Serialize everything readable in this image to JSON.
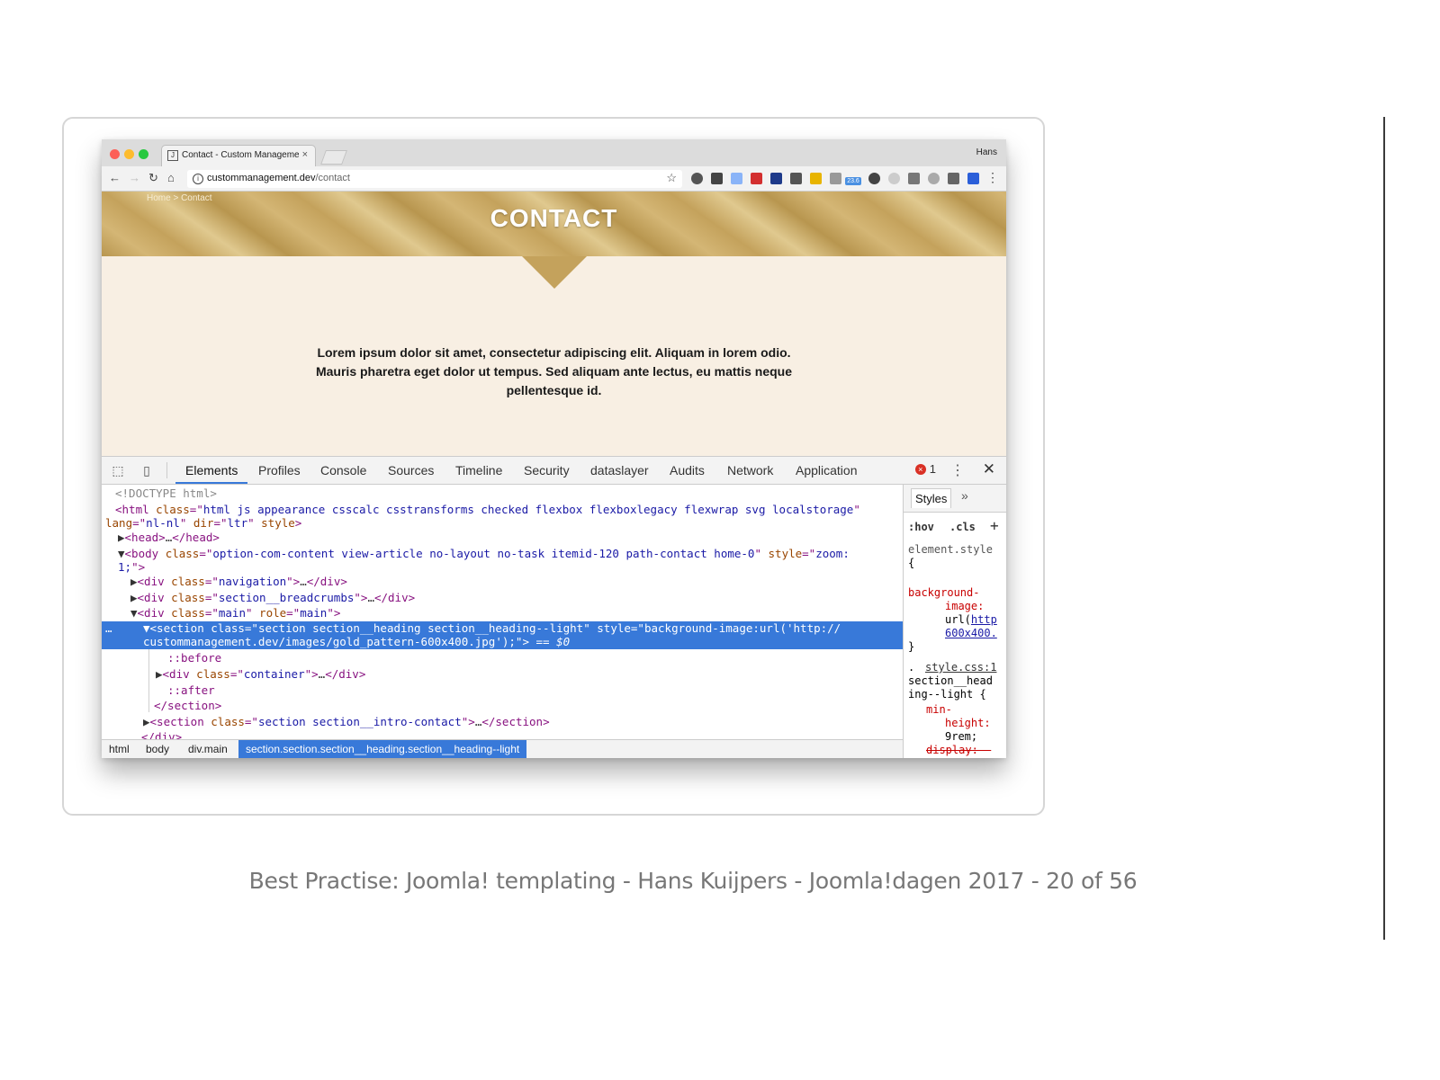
{
  "browser": {
    "tab_title": "Contact - Custom Managemen",
    "tab_favicon": "J",
    "tab_close": "×",
    "profile_name": "Hans",
    "url_host": "custommanagement.dev",
    "url_path": "/contact"
  },
  "icons": {
    "back": "←",
    "forward": "→",
    "reload": "↻",
    "home": "⌂",
    "info": "i",
    "star": "☆",
    "menu": "⋮"
  },
  "extensions": [
    "info-ext",
    "pocket-ext",
    "screen-ext",
    "lastpass-ext",
    "vue-ext",
    "dict-ext",
    "js-ext",
    "camera-ext",
    "cloud-ext",
    "timer-ext",
    "sync-ext",
    "cast-ext",
    "speed-ext",
    "shield-ext",
    "blue-ext"
  ],
  "extension_badge": "23.6",
  "page": {
    "breadcrumb": "Home > Contact",
    "title": "CONTACT",
    "intro_line1": "Lorem ipsum dolor sit amet, consectetur adipiscing elit. Aliquam in lorem odio.",
    "intro_line2": "Mauris pharetra eget dolor ut tempus. Sed aliquam ante lectus, eu mattis neque",
    "intro_line3": "pellentesque id."
  },
  "devtools": {
    "tabs": [
      "Elements",
      "Profiles",
      "Console",
      "Sources",
      "Timeline",
      "Security",
      "dataslayer",
      "Audits",
      "Network",
      "Application"
    ],
    "error_count": "1",
    "error_glyph": "×",
    "more_glyph": "⋮",
    "close_glyph": "✕",
    "breadcrumbs": [
      "html",
      "body",
      "div.main"
    ],
    "breadcrumb_active": "section.section.section__heading.section__heading--light",
    "styles_tab": "Styles",
    "styles_more": "»",
    "styles": {
      "hov": ":hov",
      "cls": ".cls",
      "add": "+",
      "element_style": "element.style",
      "brace_open": "{",
      "brace_close": "}",
      "bg_prop_1": "background-",
      "bg_prop_2": "image:",
      "bg_val_1": "url(http",
      "bg_val_2": "600x400.",
      "source": "style.css:1",
      "rule_dot": ".",
      "selector_1": "section__head",
      "selector_2": "ing--light {",
      "min_1": "min-",
      "min_2": "height:",
      "min_val": "9rem;",
      "display": "display: -"
    }
  },
  "dom": {
    "doctype": "<!DOCTYPE html>",
    "html_attr_class": "html js appearance csscalc csstransforms checked flexbox flexboxlegacy flexwrap svg localstorage",
    "lang": "nl-nl",
    "dir": "ltr",
    "body_class": "option-com-content view-article no-layout no-task itemid-120  path-contact home-0",
    "body_style_1": "zoom:",
    "body_style_2": "1;",
    "nav_class": "navigation",
    "breadcrumbs_class": "section__breadcrumbs",
    "main_class": "main",
    "main_role": "main",
    "section_class": "section section__heading section__heading--light",
    "section_style_1": "background-image:url('http://",
    "section_style_2": "custommanagement.dev/images/gold_pattern-600x400.jpg');",
    "dollar0": "== $0",
    "before": "::before",
    "container_class": "container",
    "after": "::after",
    "intro_class": "section section__intro-contact",
    "ellipsis": "…"
  },
  "caption": "Best Practise: Joomla! templating - Hans Kuijpers - Joomla!dagen 2017 - 20 of 56",
  "colors": {
    "accent": "#3879d9",
    "gold": "#c4a25c",
    "cream": "#f8efe3"
  }
}
